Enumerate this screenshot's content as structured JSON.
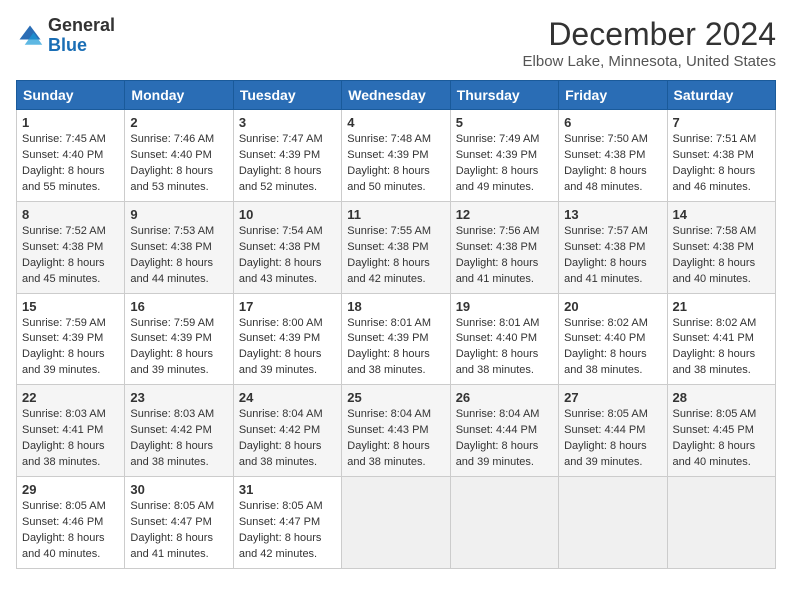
{
  "header": {
    "logo_line1": "General",
    "logo_line2": "Blue",
    "month_title": "December 2024",
    "location": "Elbow Lake, Minnesota, United States"
  },
  "weekdays": [
    "Sunday",
    "Monday",
    "Tuesday",
    "Wednesday",
    "Thursday",
    "Friday",
    "Saturday"
  ],
  "weeks": [
    [
      {
        "num": "1",
        "rise": "7:45 AM",
        "set": "4:40 PM",
        "daylight": "8 hours and 55 minutes."
      },
      {
        "num": "2",
        "rise": "7:46 AM",
        "set": "4:40 PM",
        "daylight": "8 hours and 53 minutes."
      },
      {
        "num": "3",
        "rise": "7:47 AM",
        "set": "4:39 PM",
        "daylight": "8 hours and 52 minutes."
      },
      {
        "num": "4",
        "rise": "7:48 AM",
        "set": "4:39 PM",
        "daylight": "8 hours and 50 minutes."
      },
      {
        "num": "5",
        "rise": "7:49 AM",
        "set": "4:39 PM",
        "daylight": "8 hours and 49 minutes."
      },
      {
        "num": "6",
        "rise": "7:50 AM",
        "set": "4:38 PM",
        "daylight": "8 hours and 48 minutes."
      },
      {
        "num": "7",
        "rise": "7:51 AM",
        "set": "4:38 PM",
        "daylight": "8 hours and 46 minutes."
      }
    ],
    [
      {
        "num": "8",
        "rise": "7:52 AM",
        "set": "4:38 PM",
        "daylight": "8 hours and 45 minutes."
      },
      {
        "num": "9",
        "rise": "7:53 AM",
        "set": "4:38 PM",
        "daylight": "8 hours and 44 minutes."
      },
      {
        "num": "10",
        "rise": "7:54 AM",
        "set": "4:38 PM",
        "daylight": "8 hours and 43 minutes."
      },
      {
        "num": "11",
        "rise": "7:55 AM",
        "set": "4:38 PM",
        "daylight": "8 hours and 42 minutes."
      },
      {
        "num": "12",
        "rise": "7:56 AM",
        "set": "4:38 PM",
        "daylight": "8 hours and 41 minutes."
      },
      {
        "num": "13",
        "rise": "7:57 AM",
        "set": "4:38 PM",
        "daylight": "8 hours and 41 minutes."
      },
      {
        "num": "14",
        "rise": "7:58 AM",
        "set": "4:38 PM",
        "daylight": "8 hours and 40 minutes."
      }
    ],
    [
      {
        "num": "15",
        "rise": "7:59 AM",
        "set": "4:39 PM",
        "daylight": "8 hours and 39 minutes."
      },
      {
        "num": "16",
        "rise": "7:59 AM",
        "set": "4:39 PM",
        "daylight": "8 hours and 39 minutes."
      },
      {
        "num": "17",
        "rise": "8:00 AM",
        "set": "4:39 PM",
        "daylight": "8 hours and 39 minutes."
      },
      {
        "num": "18",
        "rise": "8:01 AM",
        "set": "4:39 PM",
        "daylight": "8 hours and 38 minutes."
      },
      {
        "num": "19",
        "rise": "8:01 AM",
        "set": "4:40 PM",
        "daylight": "8 hours and 38 minutes."
      },
      {
        "num": "20",
        "rise": "8:02 AM",
        "set": "4:40 PM",
        "daylight": "8 hours and 38 minutes."
      },
      {
        "num": "21",
        "rise": "8:02 AM",
        "set": "4:41 PM",
        "daylight": "8 hours and 38 minutes."
      }
    ],
    [
      {
        "num": "22",
        "rise": "8:03 AM",
        "set": "4:41 PM",
        "daylight": "8 hours and 38 minutes."
      },
      {
        "num": "23",
        "rise": "8:03 AM",
        "set": "4:42 PM",
        "daylight": "8 hours and 38 minutes."
      },
      {
        "num": "24",
        "rise": "8:04 AM",
        "set": "4:42 PM",
        "daylight": "8 hours and 38 minutes."
      },
      {
        "num": "25",
        "rise": "8:04 AM",
        "set": "4:43 PM",
        "daylight": "8 hours and 38 minutes."
      },
      {
        "num": "26",
        "rise": "8:04 AM",
        "set": "4:44 PM",
        "daylight": "8 hours and 39 minutes."
      },
      {
        "num": "27",
        "rise": "8:05 AM",
        "set": "4:44 PM",
        "daylight": "8 hours and 39 minutes."
      },
      {
        "num": "28",
        "rise": "8:05 AM",
        "set": "4:45 PM",
        "daylight": "8 hours and 40 minutes."
      }
    ],
    [
      {
        "num": "29",
        "rise": "8:05 AM",
        "set": "4:46 PM",
        "daylight": "8 hours and 40 minutes."
      },
      {
        "num": "30",
        "rise": "8:05 AM",
        "set": "4:47 PM",
        "daylight": "8 hours and 41 minutes."
      },
      {
        "num": "31",
        "rise": "8:05 AM",
        "set": "4:47 PM",
        "daylight": "8 hours and 42 minutes."
      },
      null,
      null,
      null,
      null
    ]
  ]
}
